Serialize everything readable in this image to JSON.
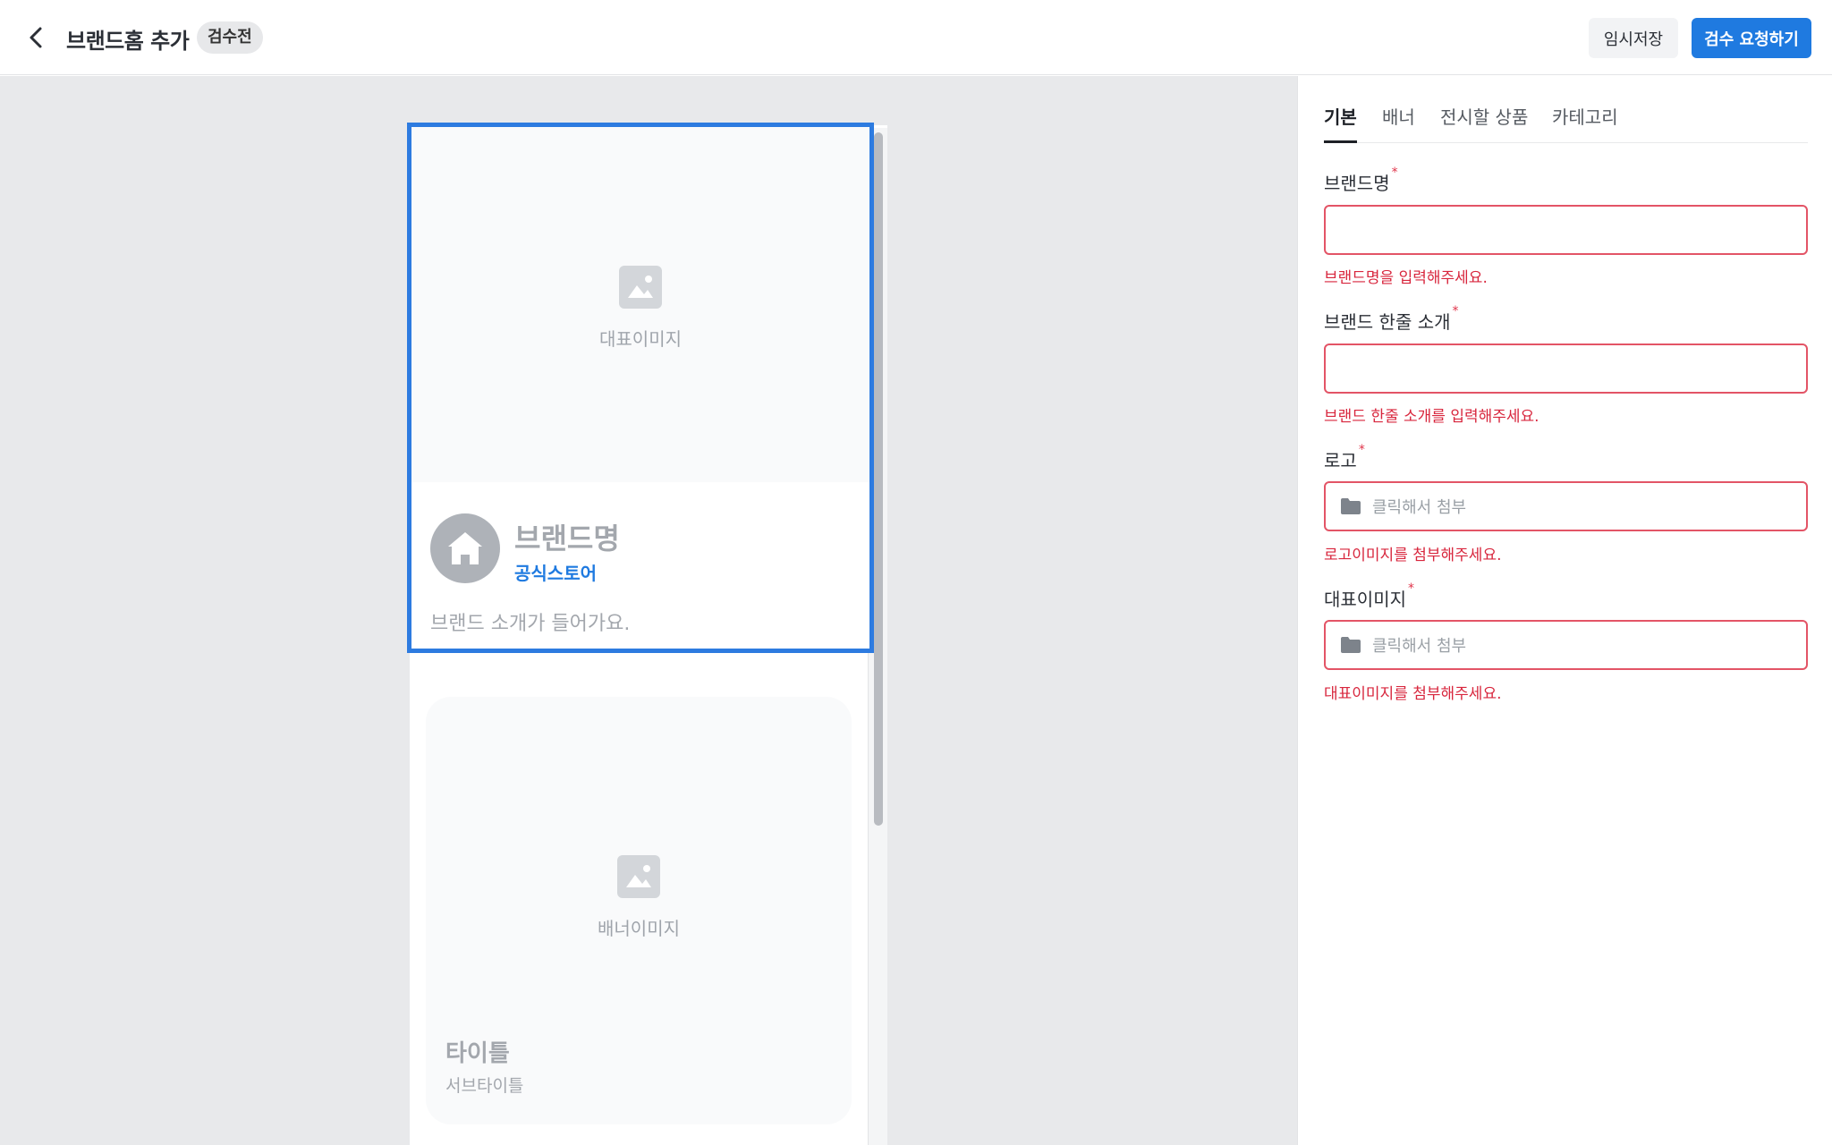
{
  "header": {
    "title": "브랜드홈 추가",
    "status": "검수전",
    "draft_label": "임시저장",
    "submit_label": "검수 요청하기"
  },
  "preview": {
    "hero_image_label": "대표이미지",
    "brand_name": "브랜드명",
    "official_label": "공식스토어",
    "brand_intro": "브랜드 소개가 들어가요.",
    "banner_image_label": "배너이미지",
    "banner_title": "타이틀",
    "banner_subtitle": "서브타이틀"
  },
  "tabs": [
    {
      "label": "기본",
      "active": true
    },
    {
      "label": "배너",
      "active": false
    },
    {
      "label": "전시할 상품",
      "active": false
    },
    {
      "label": "카테고리",
      "active": false
    }
  ],
  "form": {
    "brand_name": {
      "label": "브랜드명",
      "required_mark": "*",
      "value": "",
      "error": "브랜드명을 입력해주세요."
    },
    "brand_tagline": {
      "label": "브랜드 한줄 소개",
      "required_mark": "*",
      "value": "",
      "error": "브랜드 한줄 소개를 입력해주세요."
    },
    "logo": {
      "label": "로고",
      "required_mark": "*",
      "placeholder": "클릭해서 첨부",
      "error": "로고이미지를 첨부해주세요."
    },
    "hero_image": {
      "label": "대표이미지",
      "required_mark": "*",
      "placeholder": "클릭해서 첨부",
      "error": "대표이미지를 첨부해주세요."
    }
  },
  "colors": {
    "accent": "#1f7ae0",
    "selection_border": "#2d7be0",
    "error": "#d8263d",
    "preview_bg": "#e8e9eb"
  },
  "icons": [
    "back-arrow-icon",
    "image-icon",
    "home-icon",
    "folder-icon"
  ]
}
